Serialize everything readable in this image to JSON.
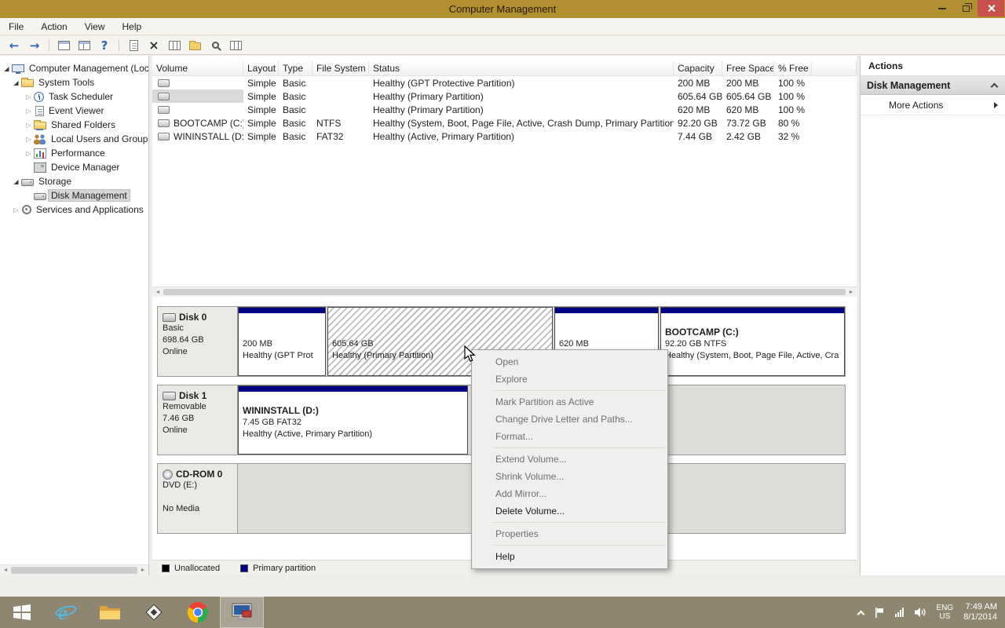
{
  "titlebar": {
    "title": "Computer Management"
  },
  "menu_bar": {
    "items": [
      {
        "label": "File"
      },
      {
        "label": "Action"
      },
      {
        "label": "View"
      },
      {
        "label": "Help"
      }
    ]
  },
  "toolbar": {
    "icons": [
      "back",
      "forward",
      "show-console-tree",
      "split-pane",
      "help",
      "export-list",
      "delete",
      "open-folder",
      "find",
      "disk-view"
    ]
  },
  "tree": {
    "items": [
      {
        "label": "Computer Management (Local",
        "icon": "computer",
        "state": "expanded",
        "selected": false
      },
      {
        "label": "System Tools",
        "icon": "system-tools-folder",
        "state": "expanded",
        "selected": false
      },
      {
        "label": "Task Scheduler",
        "icon": "task-scheduler",
        "state": "collapsed",
        "selected": false
      },
      {
        "label": "Event Viewer",
        "icon": "event-viewer",
        "state": "collapsed",
        "selected": false
      },
      {
        "label": "Shared Folders",
        "icon": "shared-folders",
        "state": "collapsed",
        "selected": false
      },
      {
        "label": "Local Users and Groups",
        "icon": "local-users-groups",
        "state": "collapsed",
        "selected": false
      },
      {
        "label": "Performance",
        "icon": "performance",
        "state": "collapsed",
        "selected": false
      },
      {
        "label": "Device Manager",
        "icon": "device-manager",
        "state": "leaf",
        "selected": false
      },
      {
        "label": "Storage",
        "icon": "storage",
        "state": "expanded",
        "selected": false
      },
      {
        "label": "Disk Management",
        "icon": "disk-management",
        "state": "leaf",
        "selected": true
      },
      {
        "label": "Services and Applications",
        "icon": "services-applications",
        "state": "collapsed",
        "selected": false
      }
    ]
  },
  "volume_list": {
    "columns": [
      {
        "label": "Volume"
      },
      {
        "label": "Layout"
      },
      {
        "label": "Type"
      },
      {
        "label": "File System"
      },
      {
        "label": "Status"
      },
      {
        "label": "Capacity"
      },
      {
        "label": "Free Space"
      },
      {
        "label": "% Free"
      }
    ],
    "rows": [
      {
        "volume": "",
        "layout": "Simple",
        "type": "Basic",
        "file_system": "",
        "status": "Healthy (GPT Protective Partition)",
        "capacity": "200 MB",
        "free_space": "200 MB",
        "pct_free": "100 %",
        "selected": false
      },
      {
        "volume": "",
        "layout": "Simple",
        "type": "Basic",
        "file_system": "",
        "status": "Healthy (Primary Partition)",
        "capacity": "605.64 GB",
        "free_space": "605.64 GB",
        "pct_free": "100 %",
        "selected": true
      },
      {
        "volume": "",
        "layout": "Simple",
        "type": "Basic",
        "file_system": "",
        "status": "Healthy (Primary Partition)",
        "capacity": "620 MB",
        "free_space": "620 MB",
        "pct_free": "100 %",
        "selected": false
      },
      {
        "volume": "BOOTCAMP (C:)",
        "layout": "Simple",
        "type": "Basic",
        "file_system": "NTFS",
        "status": "Healthy (System, Boot, Page File, Active, Crash Dump, Primary Partition)",
        "capacity": "92.20 GB",
        "free_space": "73.72 GB",
        "pct_free": "80 %",
        "selected": false
      },
      {
        "volume": "WININSTALL (D:)",
        "layout": "Simple",
        "type": "Basic",
        "file_system": "FAT32",
        "status": "Healthy (Active, Primary Partition)",
        "capacity": "7.44 GB",
        "free_space": "2.42 GB",
        "pct_free": "32 %",
        "selected": false
      }
    ]
  },
  "disks": [
    {
      "name": "Disk 0",
      "info": [
        "Basic",
        "698.64 GB",
        "Online"
      ],
      "partitions": [
        {
          "name": "",
          "size": "200 MB",
          "status": "Healthy (GPT Prot",
          "selected": false
        },
        {
          "name": "",
          "size": "605.64 GB",
          "status": "Healthy (Primary Partition)",
          "selected": true
        },
        {
          "name": "",
          "size": "620 MB",
          "status": "",
          "selected": false
        },
        {
          "name": "BOOTCAMP  (C:)",
          "size": "92.20 GB NTFS",
          "status": "Healthy (System, Boot, Page File, Active, Cra",
          "selected": false
        }
      ]
    },
    {
      "name": "Disk 1",
      "info": [
        "Removable",
        "7.46 GB",
        "Online"
      ],
      "partitions": [
        {
          "name": "WININSTALL  (D:)",
          "size": "7.45 GB FAT32",
          "status": "Healthy (Active, Primary Partition)",
          "selected": false
        }
      ]
    },
    {
      "name": "CD-ROM 0",
      "info": [
        "DVD (E:)",
        "",
        "No Media"
      ],
      "partitions": []
    }
  ],
  "context_menu": {
    "items": [
      {
        "label": "Open",
        "enabled": false
      },
      {
        "label": "Explore",
        "enabled": false
      },
      {
        "separator": true
      },
      {
        "label": "Mark Partition as Active",
        "enabled": false
      },
      {
        "label": "Change Drive Letter and Paths...",
        "enabled": false
      },
      {
        "label": "Format...",
        "enabled": false
      },
      {
        "separator": true
      },
      {
        "label": "Extend Volume...",
        "enabled": false
      },
      {
        "label": "Shrink Volume...",
        "enabled": false
      },
      {
        "label": "Add Mirror...",
        "enabled": false
      },
      {
        "label": "Delete Volume...",
        "enabled": true
      },
      {
        "separator": true
      },
      {
        "label": "Properties",
        "enabled": false
      },
      {
        "separator": true
      },
      {
        "label": "Help",
        "enabled": true
      }
    ]
  },
  "actions_panel": {
    "header": "Actions",
    "group_label": "Disk Management",
    "more_label": "More Actions"
  },
  "legend": {
    "items": [
      {
        "label": "Unallocated",
        "color": "#000000"
      },
      {
        "label": "Primary partition",
        "color": "#000083"
      }
    ]
  },
  "taskbar": {
    "buttons": [
      "start",
      "internet-explorer",
      "file-explorer",
      "app-diamond",
      "chrome",
      "computer-management"
    ],
    "tray": {
      "language_top": "ENG",
      "language_bottom": "US",
      "time": "7:49 AM",
      "date": "8/1/2014"
    }
  },
  "colors": {
    "titlebar": "#b3902f",
    "taskbar": "#8e8671",
    "primary_partition": "#000083",
    "close_button": "#c9514d",
    "selection": "#d9d9d9"
  }
}
